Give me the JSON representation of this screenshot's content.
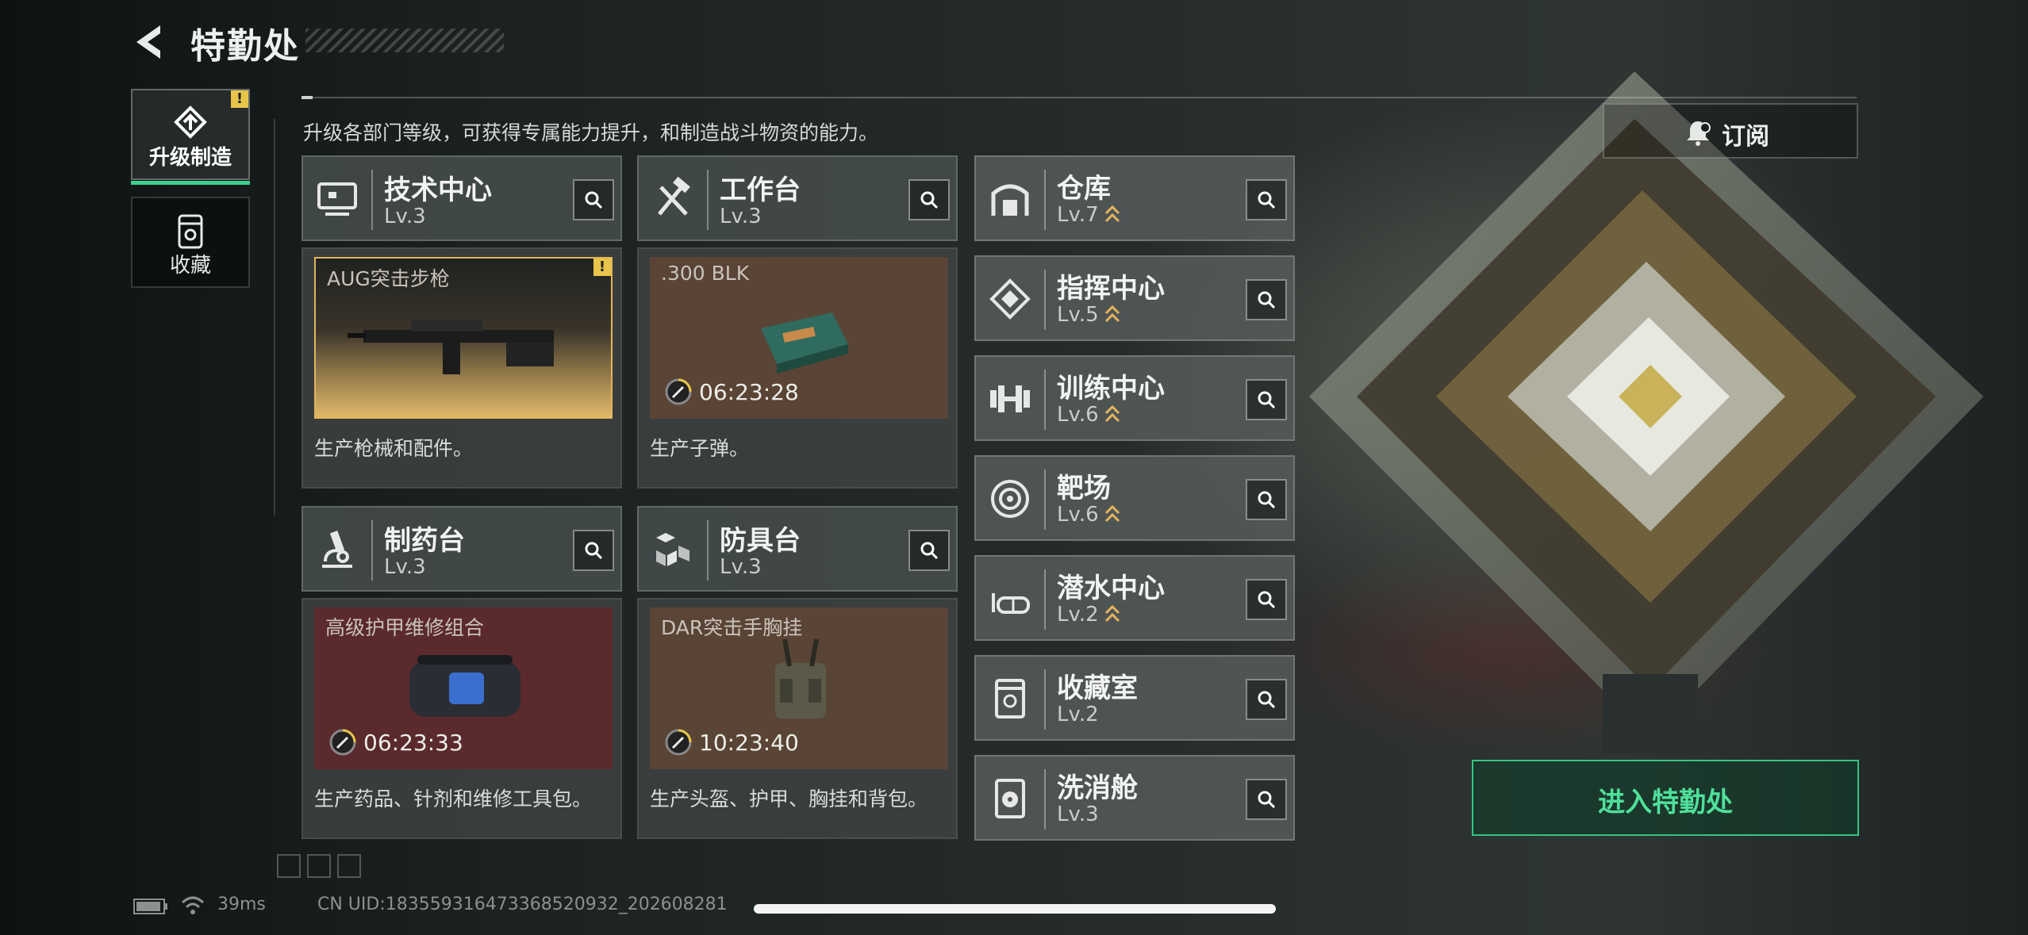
{
  "header": {
    "title": "特勤处"
  },
  "sidebar": {
    "tabs": [
      {
        "label": "升级制造",
        "active": true,
        "alert": "!"
      },
      {
        "label": "收藏",
        "active": false
      }
    ]
  },
  "description": "升级各部门等级，可获得专属能力提升，和制造战斗物资的能力。",
  "subscribe": {
    "label": "订阅"
  },
  "workstations": [
    {
      "name": "技术中心",
      "level": "Lv.3",
      "product": "AUG突击步枪",
      "timer": "",
      "note": "生产枪械和配件。",
      "alert": "!"
    },
    {
      "name": "工作台",
      "level": "Lv.3",
      "product": ".300 BLK",
      "timer": "06:23:28",
      "note": "生产子弹。"
    },
    {
      "name": "制药台",
      "level": "Lv.3",
      "product": "高级护甲维修组合",
      "timer": "06:23:33",
      "note": "生产药品、针剂和维修工具包。"
    },
    {
      "name": "防具台",
      "level": "Lv.3",
      "product": "DAR突击手胸挂",
      "timer": "10:23:40",
      "note": "生产头盔、护甲、胸挂和背包。"
    }
  ],
  "rooms": [
    {
      "name": "仓库",
      "level": "Lv.7",
      "upgradable": true
    },
    {
      "name": "指挥中心",
      "level": "Lv.5",
      "upgradable": true
    },
    {
      "name": "训练中心",
      "level": "Lv.6",
      "upgradable": true
    },
    {
      "name": "靶场",
      "level": "Lv.6",
      "upgradable": true
    },
    {
      "name": "潜水中心",
      "level": "Lv.2",
      "upgradable": true
    },
    {
      "name": "收藏室",
      "level": "Lv.2",
      "upgradable": false
    },
    {
      "name": "洗消舱",
      "level": "Lv.3",
      "upgradable": false
    }
  ],
  "enter_button": {
    "label": "进入特勤处"
  },
  "footer": {
    "ping": "39ms",
    "uid": "CN UID:18355931647336852093​2_202608281"
  },
  "colors": {
    "accent_green": "#3fcf8e",
    "gold": "#e2b45a",
    "alert_yellow": "#e8c54a"
  }
}
